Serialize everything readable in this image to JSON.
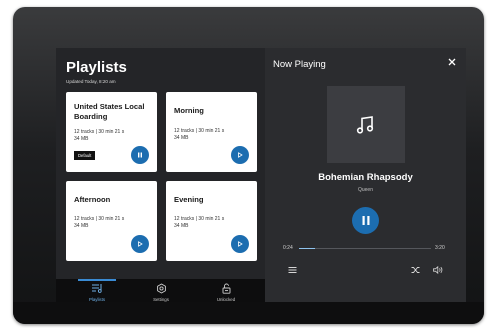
{
  "playlists": {
    "title": "Playlists",
    "updated": "Updated Today, 8:20 am",
    "cards": [
      {
        "title": "United States Local Boarding",
        "meta_tracks": "12 tracks  |  30 min 21 s",
        "meta_size": "34 MB",
        "badge": "Default",
        "button_icon": "pause-icon"
      },
      {
        "title": "Morning",
        "meta_tracks": "12 tracks  |  30 min 21 s",
        "meta_size": "34 MB",
        "button_icon": "play-icon"
      },
      {
        "title": "Afternoon",
        "meta_tracks": "12 tracks  |  30 min 21 s",
        "meta_size": "34 MB",
        "button_icon": "play-icon"
      },
      {
        "title": "Evening",
        "meta_tracks": "12 tracks  |  30 min 21 s",
        "meta_size": "34 MB",
        "button_icon": "play-icon"
      }
    ]
  },
  "nav": {
    "items": [
      {
        "label": "Playlists",
        "icon": "playlist-icon",
        "active": true
      },
      {
        "label": "Settings",
        "icon": "settings-icon",
        "active": false
      },
      {
        "label": "Unlocked",
        "icon": "unlock-icon",
        "active": false
      }
    ]
  },
  "now_playing": {
    "title": "Now Playing",
    "close_icon": "close-icon",
    "art_icon": "music-note-icon",
    "song": "Bohemian Rhapsody",
    "artist": "Queen",
    "elapsed": "0:24",
    "duration": "3:20",
    "progress": 0.12,
    "controls": {
      "queue_icon": "queue-icon",
      "shuffle_icon": "shuffle-icon",
      "volume_icon": "volume-icon"
    }
  },
  "colors": {
    "accent": "#1c6db0",
    "nav_active": "#6fb0e6",
    "panel": "#2b2c2f"
  }
}
